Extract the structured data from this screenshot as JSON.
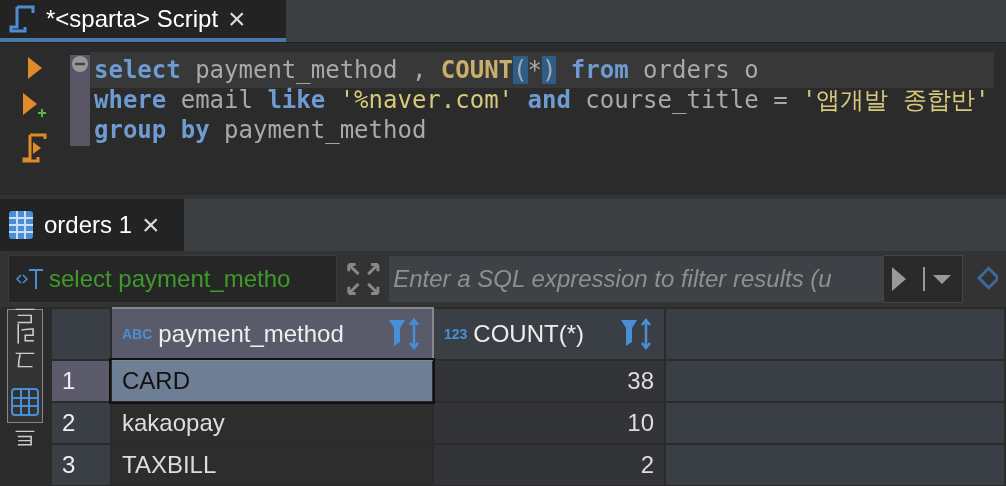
{
  "editor_tab": {
    "title": "*<sparta> Script",
    "close": "×"
  },
  "code_lines": [
    {
      "current": true,
      "tokens": [
        {
          "text": "select",
          "kind": "keyword"
        },
        {
          "text": " payment_method , ",
          "kind": "plain"
        },
        {
          "text": "COUNT",
          "kind": "function"
        },
        {
          "text": "(",
          "kind": "bracket"
        },
        {
          "text": "*",
          "kind": "plain"
        },
        {
          "text": ")",
          "kind": "bracket"
        },
        {
          "text": " from",
          "kind": "keyword"
        },
        {
          "text": " orders o",
          "kind": "plain"
        }
      ]
    },
    {
      "current": false,
      "tokens": [
        {
          "text": "where",
          "kind": "keyword"
        },
        {
          "text": " email ",
          "kind": "plain"
        },
        {
          "text": "like",
          "kind": "keyword"
        },
        {
          "text": " '%naver.com'",
          "kind": "string"
        },
        {
          "text": " and",
          "kind": "keyword"
        },
        {
          "text": " course_title = ",
          "kind": "plain"
        },
        {
          "text": "'앱개발 종합반'",
          "kind": "string"
        }
      ]
    },
    {
      "current": false,
      "tokens": [
        {
          "text": "group by",
          "kind": "keyword"
        },
        {
          "text": " payment_method",
          "kind": "plain"
        }
      ]
    }
  ],
  "results_tab": {
    "title": "orders 1",
    "close": "×"
  },
  "filter_bar": {
    "query": "select payment_metho",
    "placeholder": "Enter a SQL expression to filter results (u"
  },
  "side_tabs": [
    {
      "label": "그리드",
      "selected": true
    },
    {
      "label": "트",
      "selected": false
    }
  ],
  "table": {
    "columns": [
      {
        "type": "ABC",
        "name": "payment_method",
        "kind": "text"
      },
      {
        "type": "123",
        "name": "COUNT(*)",
        "kind": "number"
      }
    ],
    "rows": [
      {
        "number": "1",
        "selected": true,
        "cells": [
          "CARD",
          "38"
        ]
      },
      {
        "number": "2",
        "selected": false,
        "cells": [
          "kakaopay",
          "10"
        ]
      },
      {
        "number": "3",
        "selected": false,
        "cells": [
          "TAXBILL",
          "2"
        ]
      }
    ]
  }
}
